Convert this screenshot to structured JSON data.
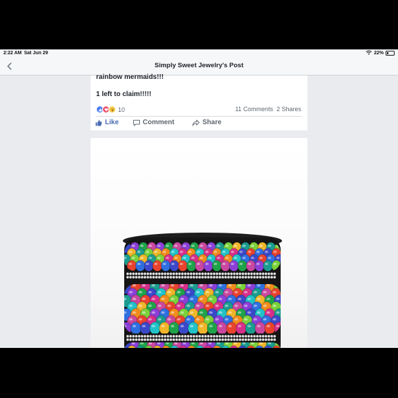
{
  "status_bar": {
    "time": "2:22 AM",
    "date": "Sat Jun 29",
    "battery": "22%",
    "battery_level": 0.22,
    "icons": [
      "wifi-icon",
      "battery-icon"
    ]
  },
  "nav": {
    "back_icon": "chevron-left-icon",
    "title": "Simply Sweet Jewelry's Post"
  },
  "post": {
    "text_line_1": "rainbow mermaids!!!",
    "text_line_2": "1 left to claim!!!!!",
    "reactions": {
      "icons": [
        "like-reaction-icon",
        "love-reaction-icon",
        "wow-reaction-icon"
      ],
      "count": "10"
    },
    "comments": "11 Comments",
    "shares": "2 Shares",
    "actions": {
      "like": "Like",
      "comment": "Comment",
      "share": "Share"
    }
  },
  "photo": {
    "subject": "rainbow-sequin-rhinestone-bracelet"
  },
  "colors": {
    "facebook_blue": "#4a6cb3",
    "feed_background": "#e9ebee",
    "text_dark": "#1d2129",
    "text_gray": "#606770"
  }
}
